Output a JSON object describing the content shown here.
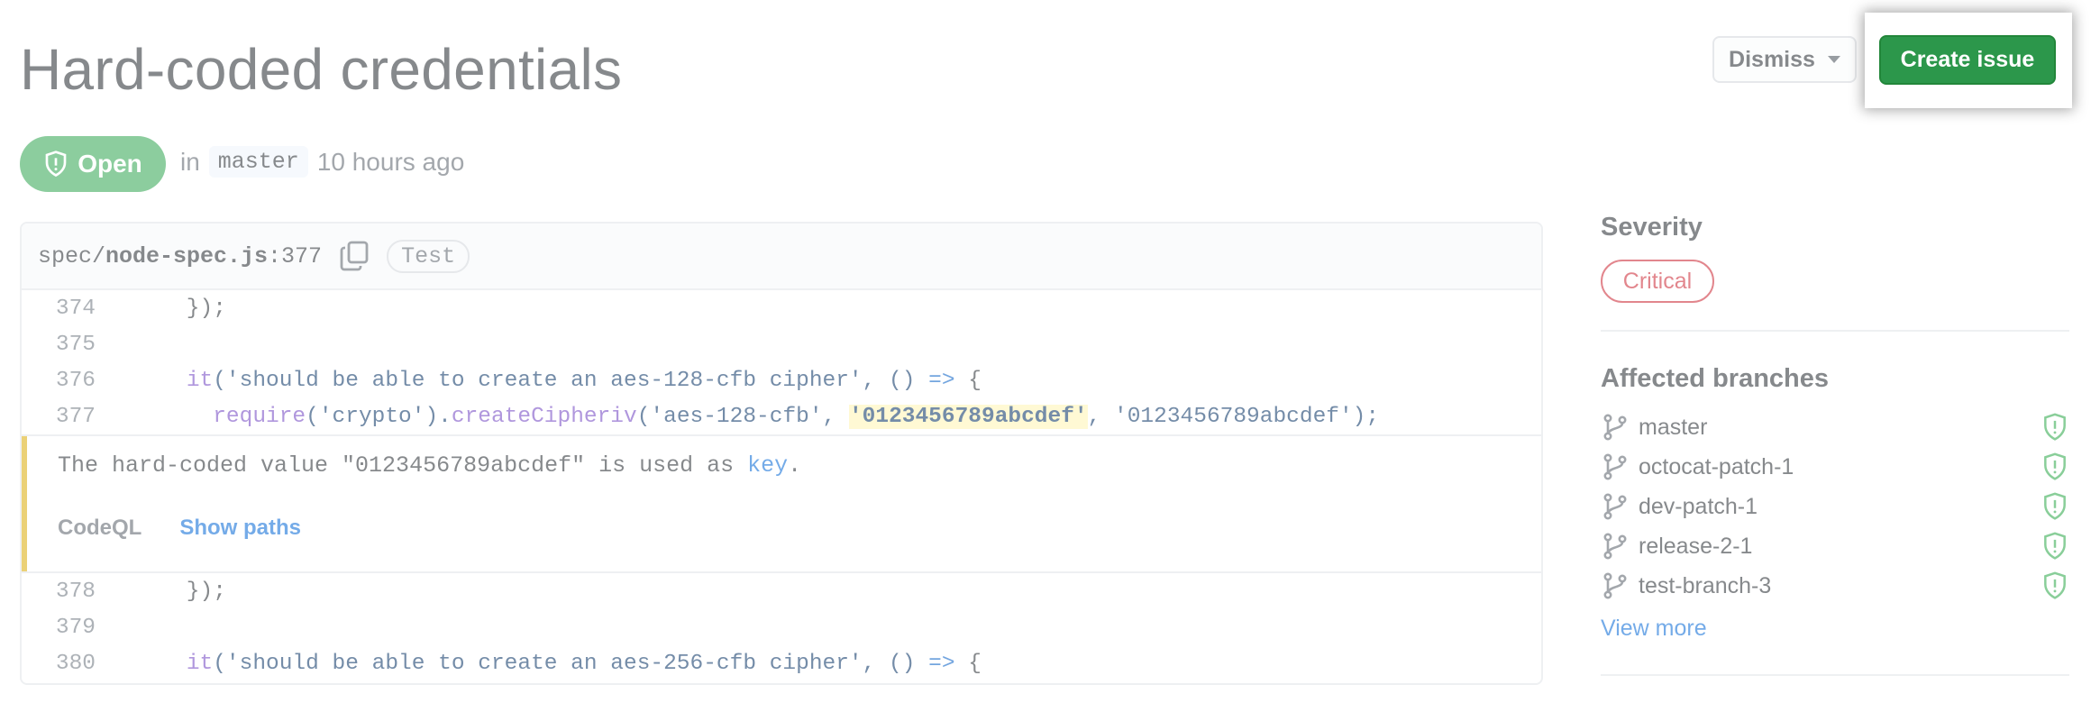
{
  "header": {
    "title": "Hard-coded credentials",
    "dismiss_label": "Dismiss",
    "create_issue_label": "Create issue"
  },
  "status": {
    "state_label": "Open",
    "in_label": "in",
    "branch": "master",
    "time": "10 hours ago"
  },
  "code": {
    "file_dir": "spec/",
    "file_name": "node-spec.js",
    "file_line": ":377",
    "tag": "Test",
    "lines_before": [
      {
        "num": "374",
        "text": "    });"
      },
      {
        "num": "375",
        "text": ""
      },
      {
        "num": "376",
        "parts": [
          "    ",
          "it",
          "('should be able to create an aes-128-cfb cipher', () ",
          "=>",
          " {"
        ]
      },
      {
        "num": "377",
        "parts": [
          "      ",
          "require",
          "('crypto').",
          "createCipheriv",
          "('aes-128-cfb', ",
          "'0123456789abcdef'",
          ", '0123456789abcdef');"
        ]
      }
    ],
    "lines_after": [
      {
        "num": "378",
        "text": "    });"
      },
      {
        "num": "379",
        "text": ""
      },
      {
        "num": "380",
        "parts": [
          "    ",
          "it",
          "('should be able to create an aes-256-cfb cipher', () ",
          "=>",
          " {"
        ]
      }
    ]
  },
  "alert": {
    "message_prefix": "The hard-coded value \"0123456789abcdef\" is used as ",
    "message_key": "key",
    "message_suffix": ".",
    "tool": "CodeQL",
    "show_paths_label": "Show paths"
  },
  "sidebar": {
    "severity_heading": "Severity",
    "severity_value": "Critical",
    "branches_heading": "Affected branches",
    "branches": [
      "master",
      "octocat-patch-1",
      "dev-patch-1",
      "release-2-1",
      "test-branch-3"
    ],
    "view_more_label": "View more"
  },
  "colors": {
    "primary_green": "#2c974b",
    "open_green": "#2ea44f",
    "critical_red": "#cb2431",
    "alert_bar": "#dbab09",
    "link_blue": "#0366d6"
  }
}
